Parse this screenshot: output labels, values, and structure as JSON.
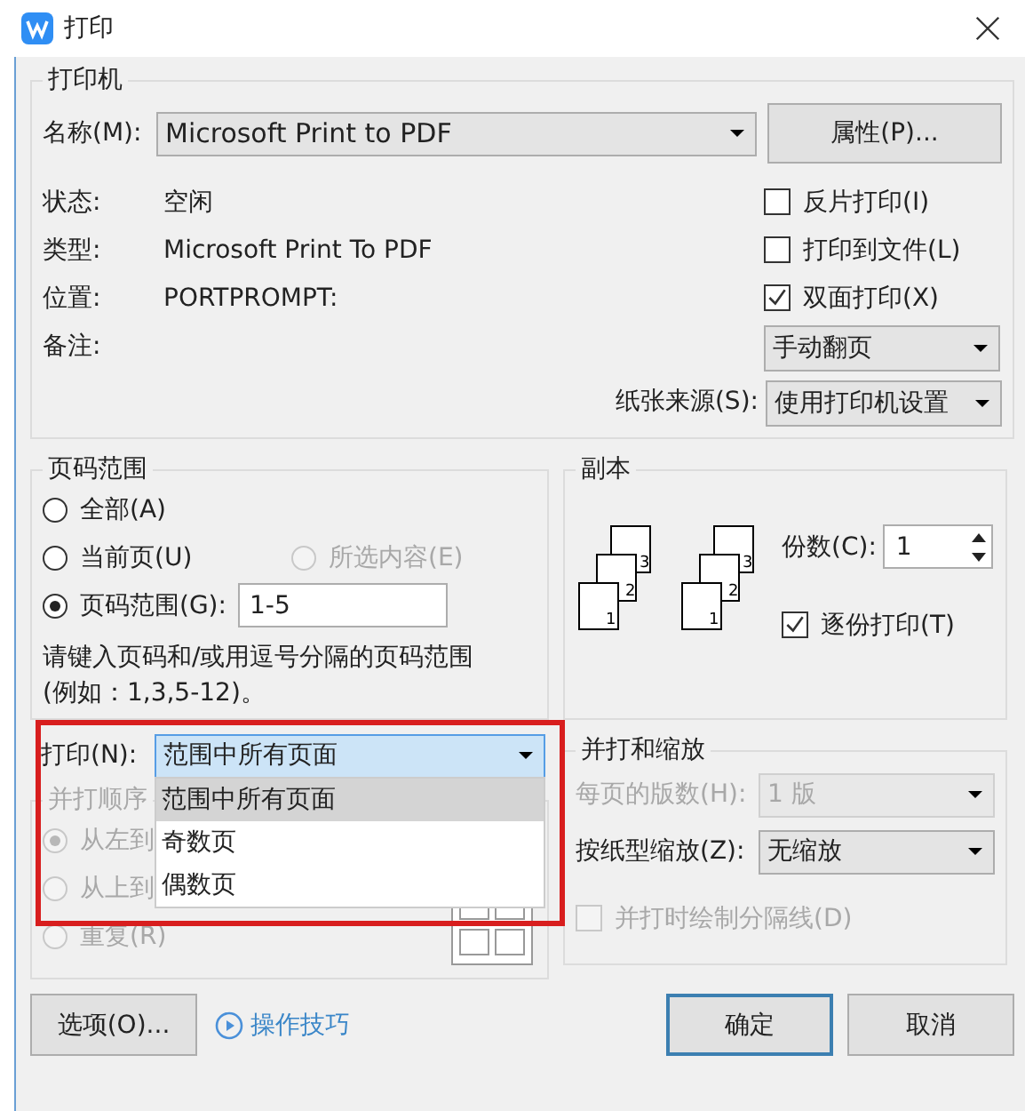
{
  "window": {
    "title": "打印"
  },
  "printer": {
    "legend": "打印机",
    "name_label": "名称(M):",
    "name_value": "Microsoft Print to PDF",
    "properties_button": "属性(P)...",
    "info": [
      {
        "label": "状态:",
        "value": "空闲"
      },
      {
        "label": "类型:",
        "value": "Microsoft Print To PDF"
      },
      {
        "label": "位置:",
        "value": "PORTPROMPT:"
      },
      {
        "label": "备注:"
      }
    ],
    "options": [
      {
        "label": "反片打印(I)",
        "checked": false
      },
      {
        "label": "打印到文件(L)",
        "checked": false
      },
      {
        "label": "双面打印(X)",
        "checked": true
      }
    ],
    "duplex_mode": "手动翻页",
    "paper_source_label": "纸张来源(S):",
    "paper_source": "使用打印机设置"
  },
  "page_range": {
    "legend": "页码范围",
    "options": [
      {
        "label": "全部(A)",
        "selected": false,
        "disabled": false
      },
      {
        "label": "当前页(U)",
        "selected": false,
        "disabled": false
      },
      {
        "label": "所选内容(E)",
        "selected": false,
        "disabled": true
      },
      {
        "label": "页码范围(G):",
        "selected": true,
        "disabled": false
      }
    ],
    "range_value": "1-5",
    "hint_lines": [
      "请键入页码和/或用逗号分隔的页码范围",
      "(例如：1,3,5-12)。"
    ]
  },
  "copies": {
    "legend": "副本",
    "count_label": "份数(C):",
    "count": "1",
    "stacks": [
      {
        "page_numbers": [
          "1",
          "2",
          "3"
        ]
      },
      {
        "page_numbers": [
          "1",
          "2",
          "3"
        ]
      }
    ],
    "collate": {
      "label": "逐份打印(T)",
      "checked": true
    }
  },
  "print_what": {
    "label": "打印(N):",
    "value": "范围中所有页面",
    "expanded": true,
    "highlighted": true,
    "options": [
      {
        "label": "范围中所有页面",
        "selected": true
      },
      {
        "label": "奇数页",
        "selected": false
      },
      {
        "label": "偶数页",
        "selected": false
      }
    ]
  },
  "order": {
    "legend": "并打顺序",
    "disabled": true,
    "options": [
      {
        "label": "从左到",
        "selected": true
      },
      {
        "label": "从上到",
        "selected": false
      },
      {
        "label": "重复(R)",
        "selected": false
      }
    ]
  },
  "zoom": {
    "legend": "并打和缩放",
    "pages_per_sheet_label": "每页的版数(H):",
    "pages_per_sheet": "1 版",
    "pages_disabled": true,
    "scale_label": "按纸型缩放(Z):",
    "scale": "无缩放",
    "separator": {
      "label": "并打时绘制分隔线(D)",
      "checked": false,
      "disabled": true
    }
  },
  "buttons": {
    "options": "选项(O)...",
    "tips": "操作技巧",
    "ok": "确定",
    "cancel": "取消"
  }
}
